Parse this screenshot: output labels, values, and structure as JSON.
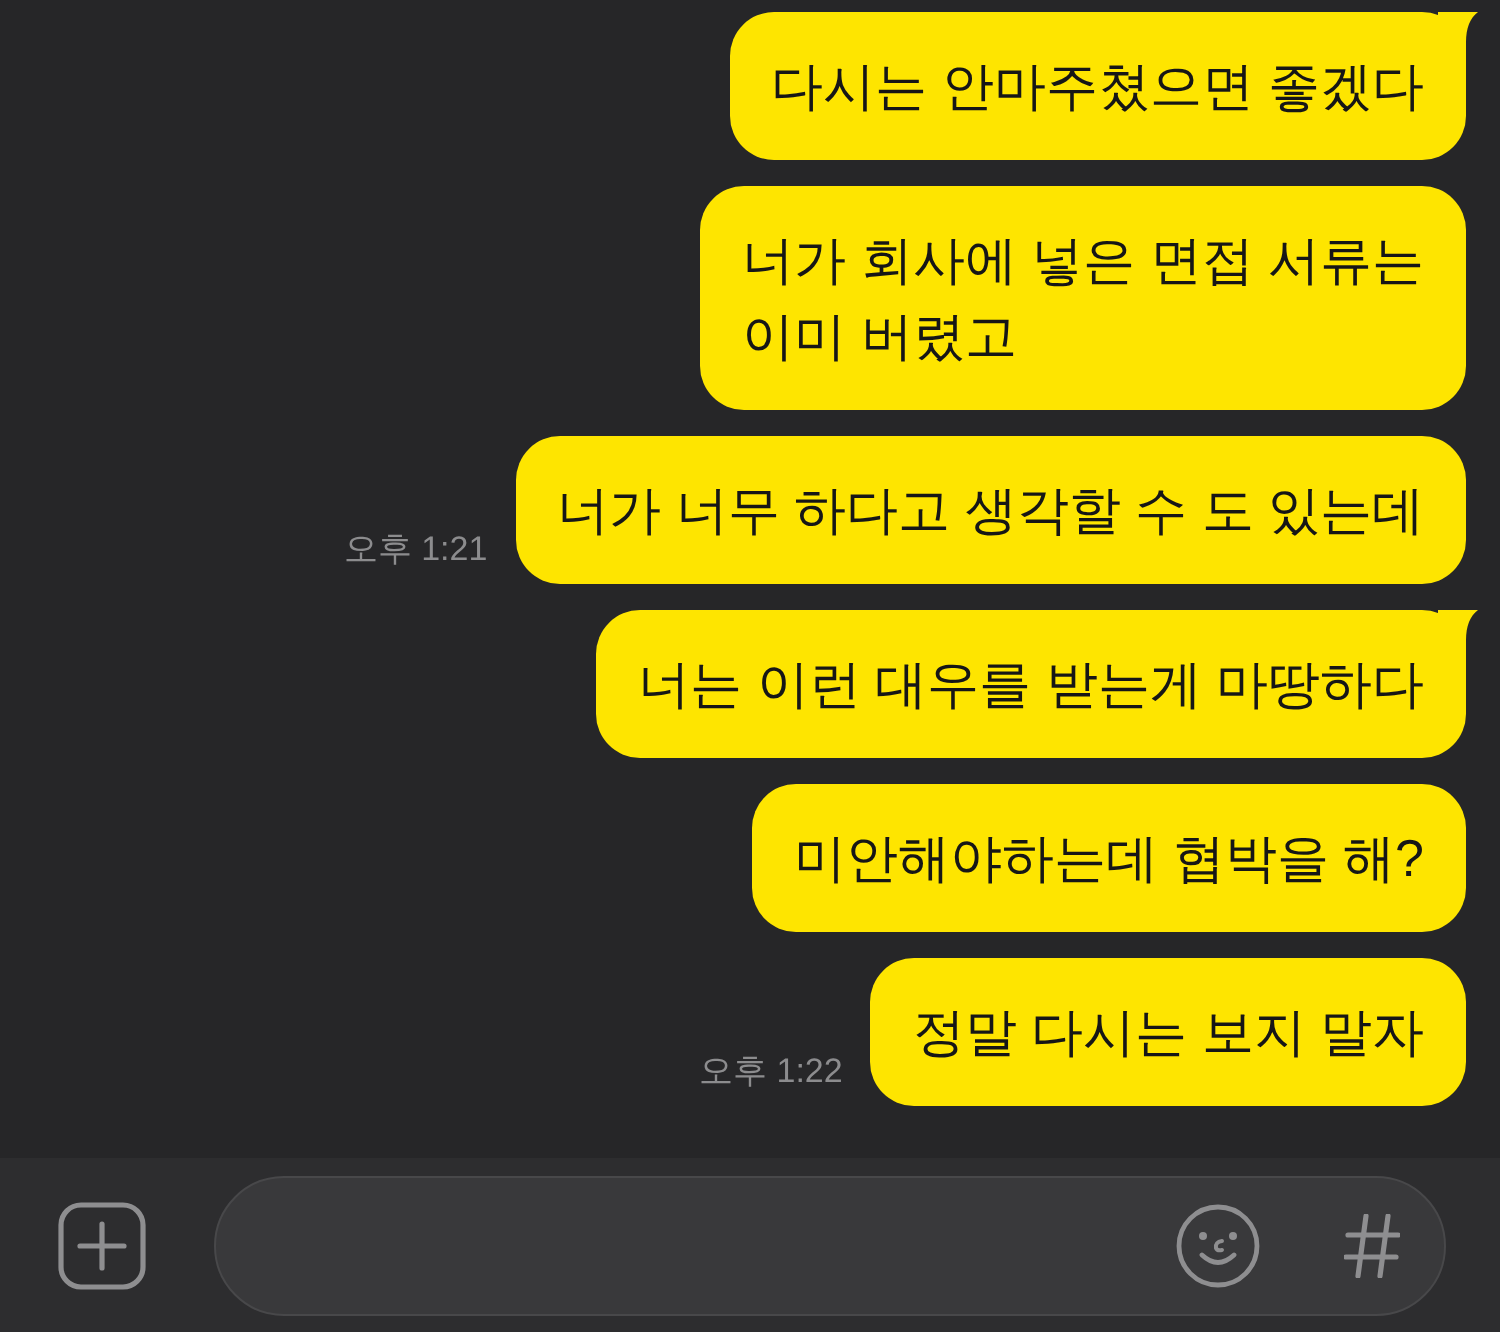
{
  "messages": [
    {
      "text": "다시는 안마주쳤으면 좋겠다",
      "tail": true
    },
    {
      "text": "너가 회사에 넣은 면접 서류는\n이미 버렸고",
      "tail": false
    },
    {
      "text": "너가 너무 하다고 생각할 수 도 있는데",
      "tail": false,
      "time": "오후 1:21"
    },
    {
      "text": "너는 이런 대우를 받는게 마땅하다",
      "tail": true
    },
    {
      "text": "미안해야하는데 협박을 해?",
      "tail": false
    },
    {
      "text": "정말 다시는 보지 말자",
      "tail": false,
      "time": "오후 1:22"
    }
  ]
}
